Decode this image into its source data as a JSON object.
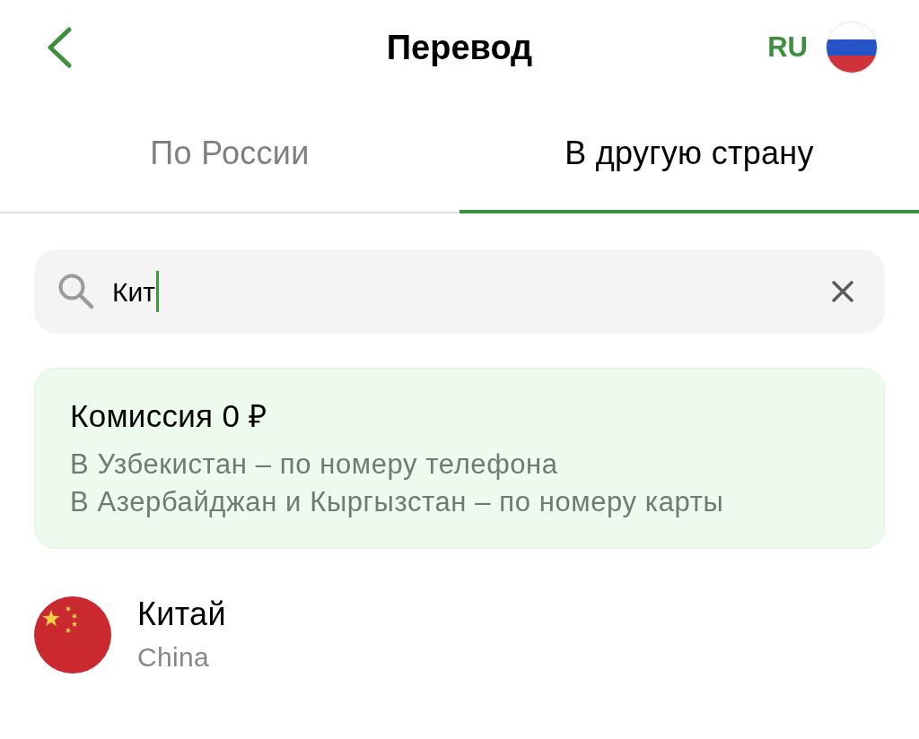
{
  "header": {
    "title": "Перевод",
    "language": "RU"
  },
  "tabs": [
    {
      "label": "По России",
      "selected": false
    },
    {
      "label": "В другую страну",
      "selected": true
    }
  ],
  "search": {
    "value": "Кит"
  },
  "promo": {
    "title": "Комиссия 0 ₽",
    "lines": [
      "В Узбекистан – по номеру телефона",
      "В Азербайджан и Кыргызстан – по номеру карты"
    ]
  },
  "countries": [
    {
      "name": "Китай",
      "name_en": "China"
    }
  ]
}
